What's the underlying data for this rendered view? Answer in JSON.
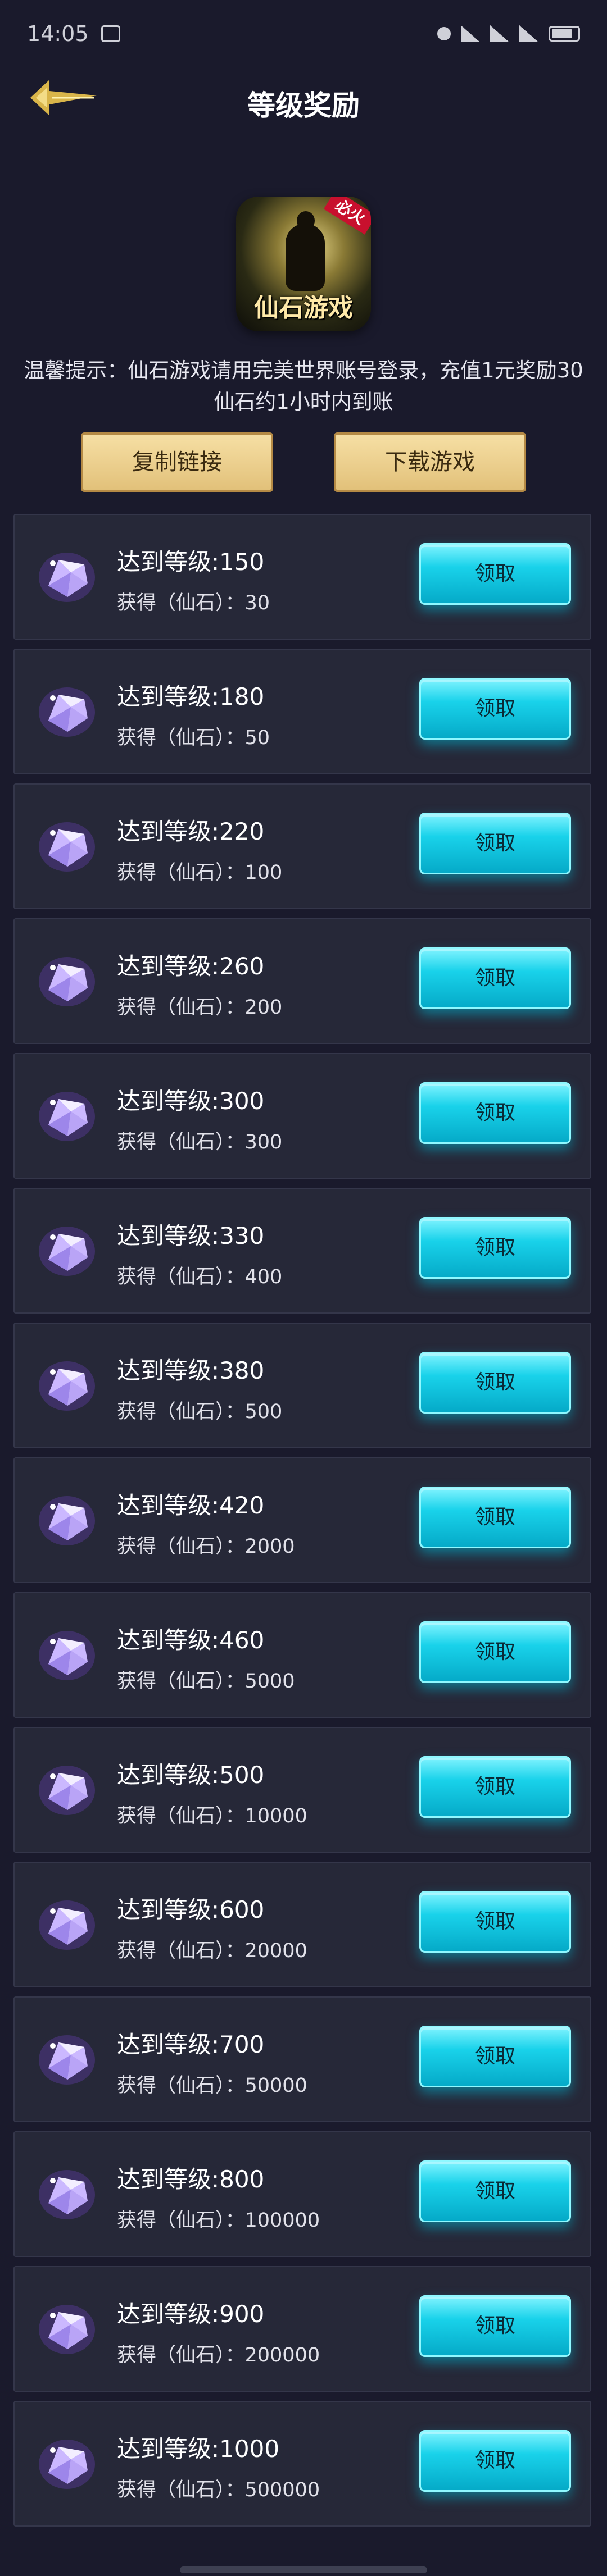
{
  "status_bar": {
    "time": "14:05"
  },
  "header": {
    "title": "等级奖励"
  },
  "app": {
    "name": "仙石游戏",
    "badge": "必火"
  },
  "tip": "温馨提示：仙石游戏请用完美世界账号登录，充值1元奖励30仙石约1小时内到账",
  "buttons": {
    "copy": "复制链接",
    "download": "下载游戏"
  },
  "rewards": [
    {
      "level": "达到等级:150",
      "reward": "获得（仙石）：30",
      "button": "领取"
    },
    {
      "level": "达到等级:180",
      "reward": "获得（仙石）：50",
      "button": "领取"
    },
    {
      "level": "达到等级:220",
      "reward": "获得（仙石）：100",
      "button": "领取"
    },
    {
      "level": "达到等级:260",
      "reward": "获得（仙石）：200",
      "button": "领取"
    },
    {
      "level": "达到等级:300",
      "reward": "获得（仙石）：300",
      "button": "领取"
    },
    {
      "level": "达到等级:330",
      "reward": "获得（仙石）：400",
      "button": "领取"
    },
    {
      "level": "达到等级:380",
      "reward": "获得（仙石）：500",
      "button": "领取"
    },
    {
      "level": "达到等级:420",
      "reward": "获得（仙石）：2000",
      "button": "领取"
    },
    {
      "level": "达到等级:460",
      "reward": "获得（仙石）：5000",
      "button": "领取"
    },
    {
      "level": "达到等级:500",
      "reward": "获得（仙石）：10000",
      "button": "领取"
    },
    {
      "level": "达到等级:600",
      "reward": "获得（仙石）：20000",
      "button": "领取"
    },
    {
      "level": "达到等级:700",
      "reward": "获得（仙石）：50000",
      "button": "领取"
    },
    {
      "level": "达到等级:800",
      "reward": "获得（仙石）：100000",
      "button": "领取"
    },
    {
      "level": "达到等级:900",
      "reward": "获得（仙石）：200000",
      "button": "领取"
    },
    {
      "level": "达到等级:1000",
      "reward": "获得（仙石）：500000",
      "button": "领取"
    }
  ],
  "icons": {
    "back": "back-arrow-icon",
    "gem": "gem-icon"
  },
  "colors": {
    "background": "#1a1a2c",
    "card": "#262838",
    "claim": "#19d2ea",
    "gold": "#e9c98a"
  }
}
